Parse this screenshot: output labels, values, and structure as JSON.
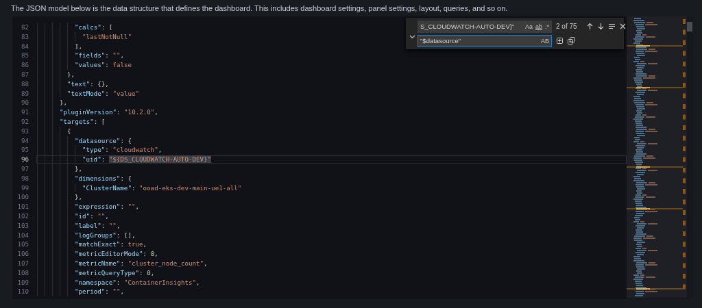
{
  "description": "The JSON model below is the data structure that defines the dashboard. This includes dashboard settings, panel settings, layout, queries, and so on.",
  "editor": {
    "lines": [
      {
        "number": "82",
        "selected": false,
        "tokens": [
          {
            "kind": "key",
            "text": "\"calcs\""
          },
          {
            "kind": "punct",
            "text": ": ["
          }
        ]
      },
      {
        "number": "83",
        "selected": false,
        "tokens": [
          {
            "kind": "str",
            "text": "\"lastNotNull\""
          }
        ]
      },
      {
        "number": "84",
        "selected": false,
        "tokens": [
          {
            "kind": "punct",
            "text": "],"
          }
        ]
      },
      {
        "number": "85",
        "selected": false,
        "tokens": [
          {
            "kind": "key",
            "text": "\"fields\""
          },
          {
            "kind": "punct",
            "text": ": "
          },
          {
            "kind": "str",
            "text": "\"\""
          },
          {
            "kind": "punct",
            "text": ","
          }
        ]
      },
      {
        "number": "86",
        "selected": false,
        "tokens": [
          {
            "kind": "key",
            "text": "\"values\""
          },
          {
            "kind": "punct",
            "text": ": "
          },
          {
            "kind": "kw",
            "text": "false"
          }
        ]
      },
      {
        "number": "87",
        "selected": false,
        "tokens": [
          {
            "kind": "punct",
            "text": "},"
          }
        ]
      },
      {
        "number": "88",
        "selected": false,
        "tokens": [
          {
            "kind": "key",
            "text": "\"text\""
          },
          {
            "kind": "punct",
            "text": ": {},"
          }
        ]
      },
      {
        "number": "89",
        "selected": false,
        "tokens": [
          {
            "kind": "key",
            "text": "\"textMode\""
          },
          {
            "kind": "punct",
            "text": ": "
          },
          {
            "kind": "str",
            "text": "\"value\""
          }
        ]
      },
      {
        "number": "90",
        "selected": false,
        "tokens": [
          {
            "kind": "punct",
            "text": "},"
          }
        ]
      },
      {
        "number": "91",
        "selected": false,
        "tokens": [
          {
            "kind": "key",
            "text": "\"pluginVersion\""
          },
          {
            "kind": "punct",
            "text": ": "
          },
          {
            "kind": "str",
            "text": "\"10.2.0\""
          },
          {
            "kind": "punct",
            "text": ","
          }
        ]
      },
      {
        "number": "92",
        "selected": false,
        "tokens": [
          {
            "kind": "key",
            "text": "\"targets\""
          },
          {
            "kind": "punct",
            "text": ": ["
          }
        ]
      },
      {
        "number": "93",
        "selected": false,
        "tokens": [
          {
            "kind": "punct",
            "text": "{"
          }
        ]
      },
      {
        "number": "94",
        "selected": false,
        "tokens": [
          {
            "kind": "key",
            "text": "\"datasource\""
          },
          {
            "kind": "punct",
            "text": ": {"
          }
        ]
      },
      {
        "number": "95",
        "selected": false,
        "tokens": [
          {
            "kind": "key",
            "text": "\"type\""
          },
          {
            "kind": "punct",
            "text": ": "
          },
          {
            "kind": "str",
            "text": "\"cloudwatch\""
          },
          {
            "kind": "punct",
            "text": ","
          }
        ]
      },
      {
        "number": "96",
        "selected": true,
        "tokens": [
          {
            "kind": "key",
            "text": "\"uid\""
          },
          {
            "kind": "punct",
            "text": ": "
          },
          {
            "kind": "sel",
            "text": "\"${DS_CLOUDWATCH-AUTO-DEV}\""
          }
        ]
      },
      {
        "number": "97",
        "selected": false,
        "tokens": [
          {
            "kind": "punct",
            "text": "},"
          }
        ]
      },
      {
        "number": "98",
        "selected": false,
        "tokens": [
          {
            "kind": "key",
            "text": "\"dimensions\""
          },
          {
            "kind": "punct",
            "text": ": {"
          }
        ]
      },
      {
        "number": "99",
        "selected": false,
        "tokens": [
          {
            "kind": "key",
            "text": "\"ClusterName\""
          },
          {
            "kind": "punct",
            "text": ": "
          },
          {
            "kind": "str",
            "text": "\"ooad-eks-dev-main-ue1-all\""
          }
        ]
      },
      {
        "number": "100",
        "selected": false,
        "tokens": [
          {
            "kind": "punct",
            "text": "},"
          }
        ]
      },
      {
        "number": "101",
        "selected": false,
        "tokens": [
          {
            "kind": "key",
            "text": "\"expression\""
          },
          {
            "kind": "punct",
            "text": ": "
          },
          {
            "kind": "str",
            "text": "\"\""
          },
          {
            "kind": "punct",
            "text": ","
          }
        ]
      },
      {
        "number": "102",
        "selected": false,
        "tokens": [
          {
            "kind": "key",
            "text": "\"id\""
          },
          {
            "kind": "punct",
            "text": ": "
          },
          {
            "kind": "str",
            "text": "\"\""
          },
          {
            "kind": "punct",
            "text": ","
          }
        ]
      },
      {
        "number": "103",
        "selected": false,
        "tokens": [
          {
            "kind": "key",
            "text": "\"label\""
          },
          {
            "kind": "punct",
            "text": ": "
          },
          {
            "kind": "str",
            "text": "\"\""
          },
          {
            "kind": "punct",
            "text": ","
          }
        ]
      },
      {
        "number": "104",
        "selected": false,
        "tokens": [
          {
            "kind": "key",
            "text": "\"logGroups\""
          },
          {
            "kind": "punct",
            "text": ": [],"
          }
        ]
      },
      {
        "number": "105",
        "selected": false,
        "tokens": [
          {
            "kind": "key",
            "text": "\"matchExact\""
          },
          {
            "kind": "punct",
            "text": ": "
          },
          {
            "kind": "kw",
            "text": "true"
          },
          {
            "kind": "punct",
            "text": ","
          }
        ]
      },
      {
        "number": "106",
        "selected": false,
        "tokens": [
          {
            "kind": "key",
            "text": "\"metricEditorMode\""
          },
          {
            "kind": "punct",
            "text": ": "
          },
          {
            "kind": "num",
            "text": "0"
          },
          {
            "kind": "punct",
            "text": ","
          }
        ]
      },
      {
        "number": "107",
        "selected": false,
        "tokens": [
          {
            "kind": "key",
            "text": "\"metricName\""
          },
          {
            "kind": "punct",
            "text": ": "
          },
          {
            "kind": "str",
            "text": "\"cluster_node_count\""
          },
          {
            "kind": "punct",
            "text": ","
          }
        ]
      },
      {
        "number": "108",
        "selected": false,
        "tokens": [
          {
            "kind": "key",
            "text": "\"metricQueryType\""
          },
          {
            "kind": "punct",
            "text": ": "
          },
          {
            "kind": "num",
            "text": "0"
          },
          {
            "kind": "punct",
            "text": ","
          }
        ]
      },
      {
        "number": "109",
        "selected": false,
        "tokens": [
          {
            "kind": "key",
            "text": "\"namespace\""
          },
          {
            "kind": "punct",
            "text": ": "
          },
          {
            "kind": "str",
            "text": "\"ContainerInsights\""
          },
          {
            "kind": "punct",
            "text": ","
          }
        ]
      },
      {
        "number": "110",
        "selected": false,
        "tokens": [
          {
            "kind": "key",
            "text": "\"period\""
          },
          {
            "kind": "punct",
            "text": ": "
          },
          {
            "kind": "str",
            "text": "\"\""
          },
          {
            "kind": "punct",
            "text": ","
          }
        ]
      }
    ]
  },
  "find_widget": {
    "find_value": "S_CLOUDWATCH-AUTO-DEV}\"",
    "match_case": "Aa",
    "whole_word": "ab",
    "regex": ".*",
    "match_count": "2 of 75",
    "replace_value": "\"$datasource\"",
    "preserve_case": "AB"
  }
}
